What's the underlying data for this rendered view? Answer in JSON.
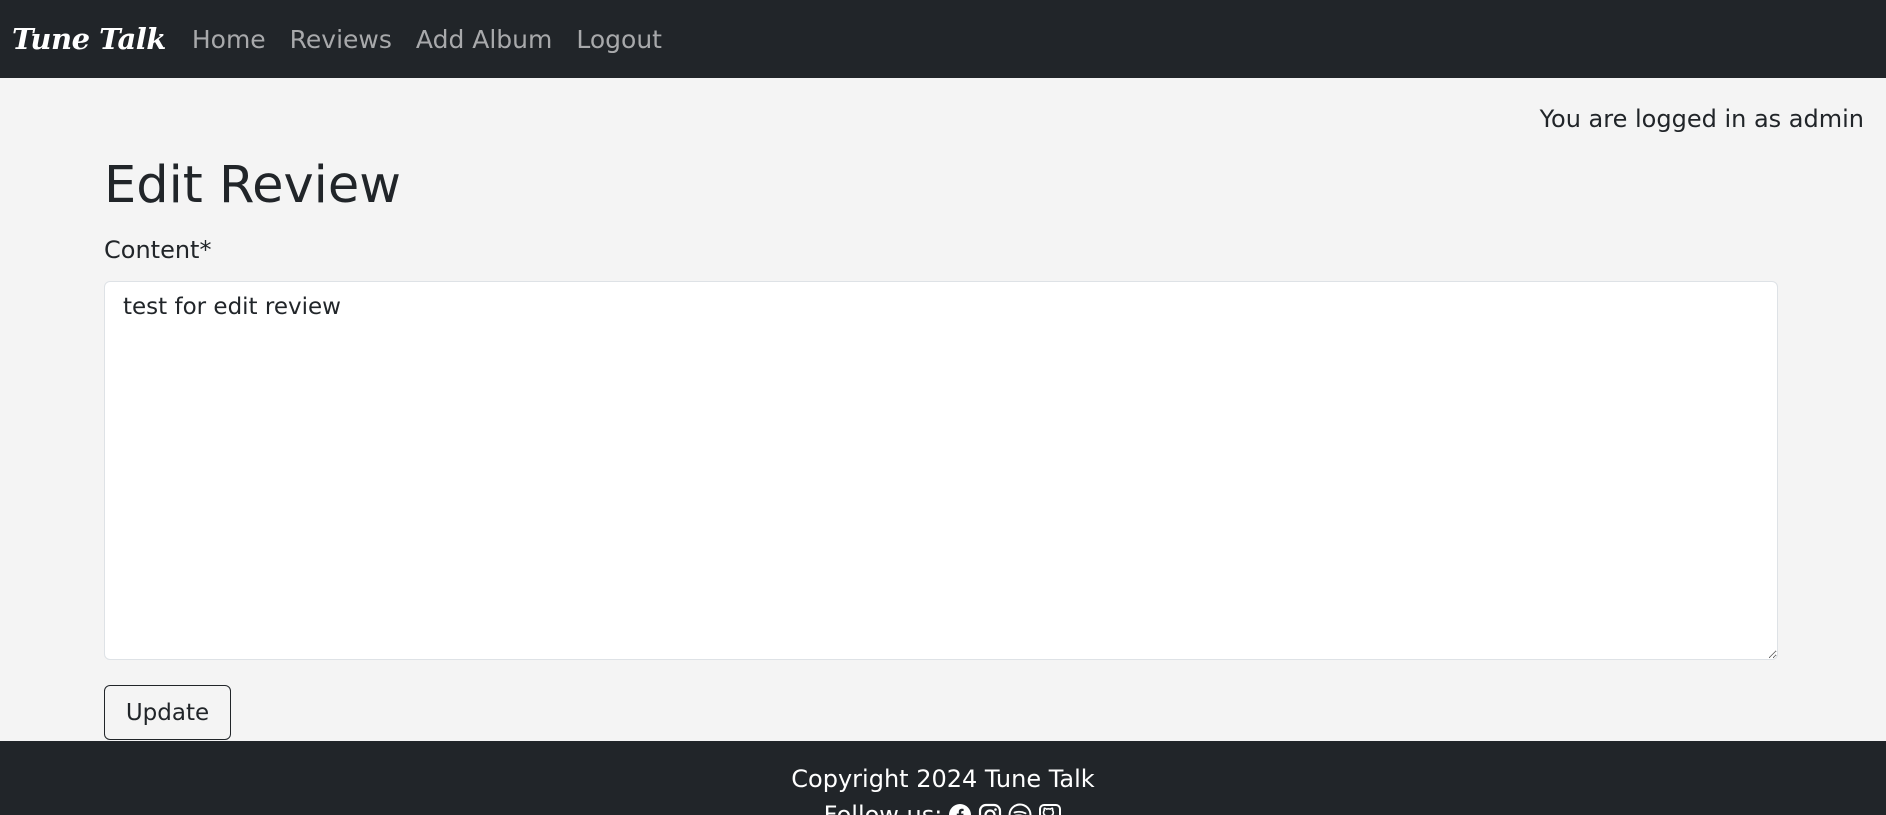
{
  "navbar": {
    "brand": "Tune Talk",
    "links": [
      {
        "label": "Home"
      },
      {
        "label": "Reviews"
      },
      {
        "label": "Add Album"
      },
      {
        "label": "Logout"
      }
    ]
  },
  "status": {
    "login_text": "You are logged in as admin"
  },
  "form": {
    "title": "Edit Review",
    "content_label": "Content*",
    "content_value": "test for edit review",
    "submit_label": "Update"
  },
  "footer": {
    "copyright": "Copyright 2024 Tune Talk",
    "follow_label": "Follow us:",
    "social_icons": [
      "facebook-icon",
      "instagram-icon",
      "spotify-icon",
      "github-icon"
    ]
  },
  "colors": {
    "navbar_bg": "#212529",
    "page_bg": "#f4f4f4",
    "nav_link": "#a8a9ab",
    "text": "#212529"
  }
}
